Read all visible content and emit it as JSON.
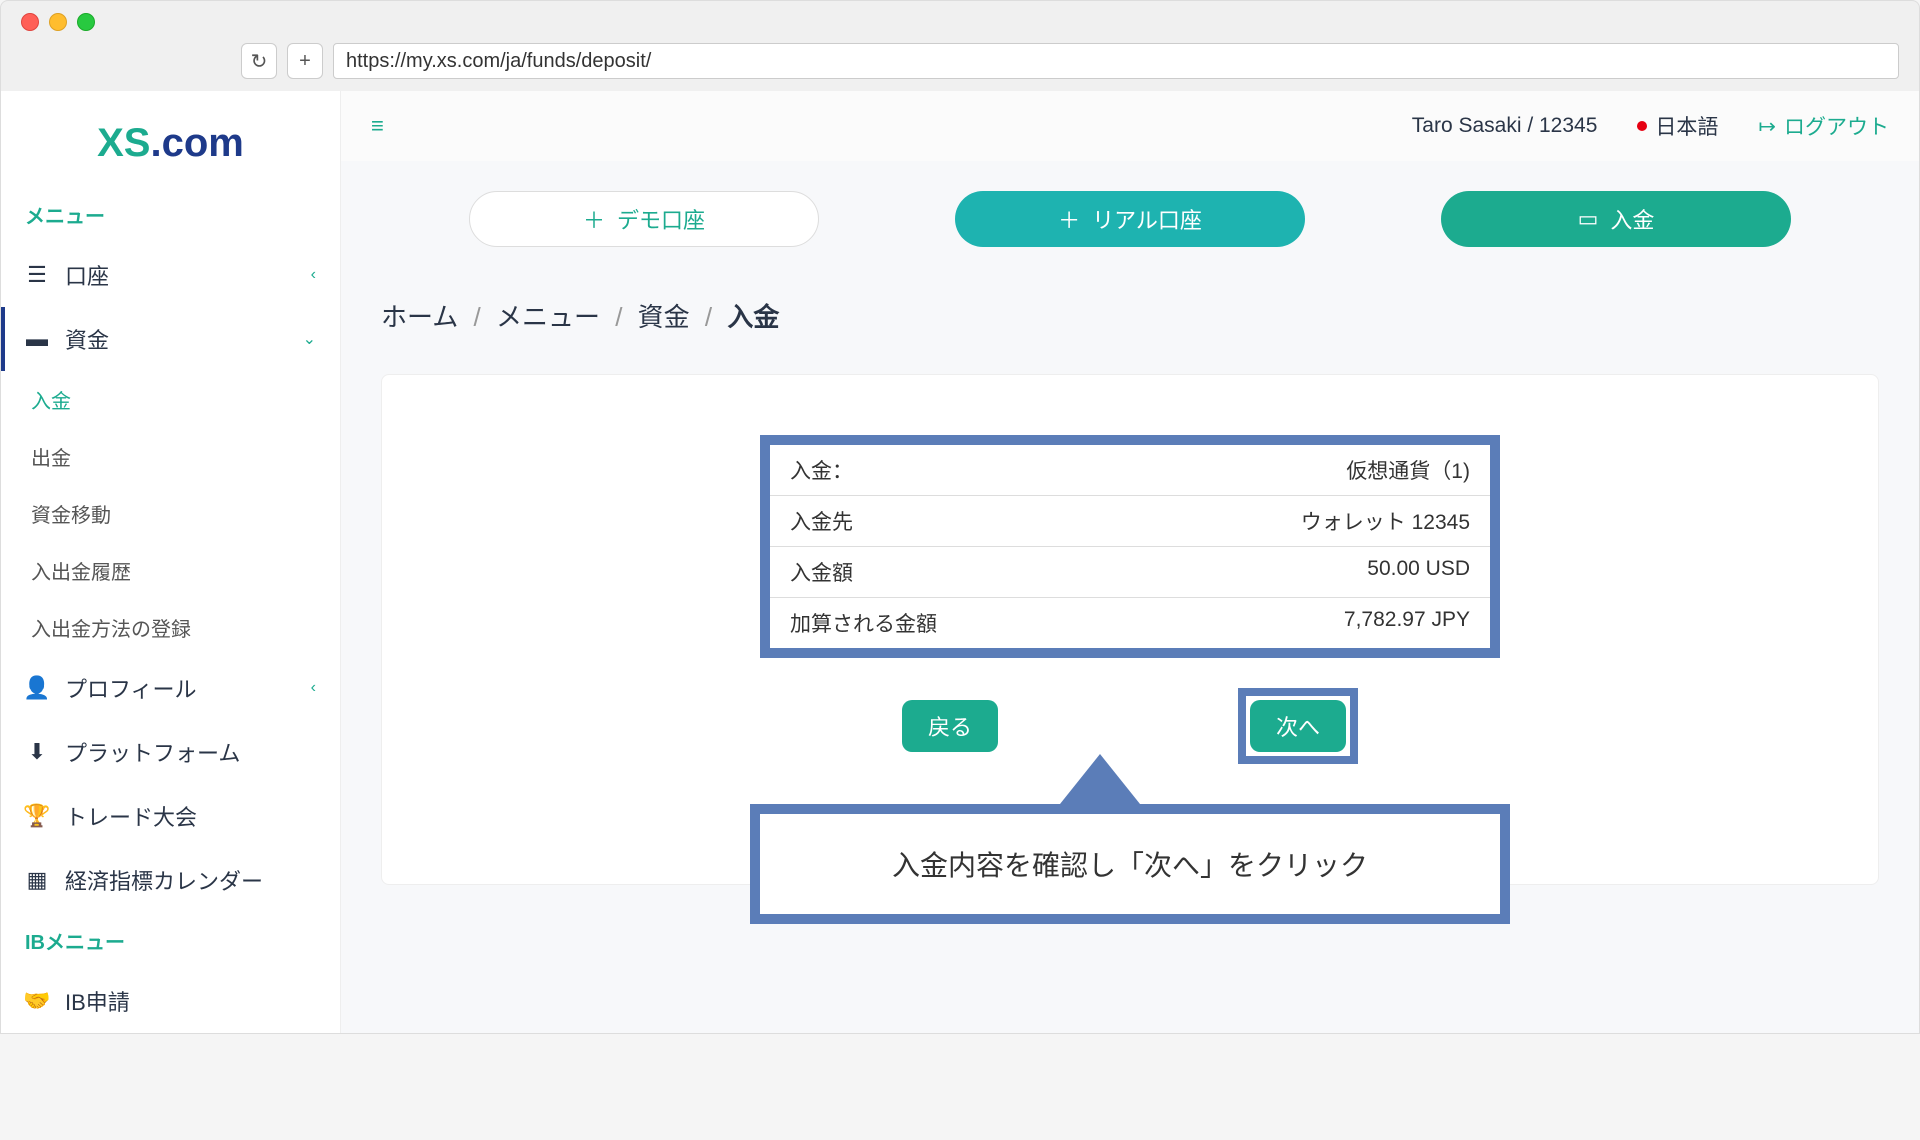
{
  "browser": {
    "url": "https://my.xs.com/ja/funds/deposit/"
  },
  "logo": {
    "xs": "XS",
    "dot": ".",
    "com": "com"
  },
  "sidebar": {
    "menu_header": "メニュー",
    "items": {
      "account": "口座",
      "funds": "資金",
      "profile": "プロフィール",
      "platform": "プラットフォーム",
      "contest": "トレード大会",
      "calendar": "経済指標カレンダー"
    },
    "funds_sub": {
      "deposit": "入金",
      "withdraw": "出金",
      "transfer": "資金移動",
      "history": "入出金履歴",
      "methods": "入出金方法の登録"
    },
    "ib_header": "IBメニュー",
    "ib_apply": "IB申請"
  },
  "topbar": {
    "user": "Taro Sasaki / 12345",
    "language": "日本語",
    "logout": "ログアウト"
  },
  "actions": {
    "demo": "デモ口座",
    "real": "リアル口座",
    "deposit": "入金"
  },
  "breadcrumb": {
    "home": "ホーム",
    "menu": "メニュー",
    "funds": "資金",
    "deposit": "入金"
  },
  "summary": {
    "rows": [
      {
        "label": "入金：",
        "value": "仮想通貨（1)"
      },
      {
        "label": "入金先",
        "value": "ウォレット 12345"
      },
      {
        "label": "入金額",
        "value": "50.00 USD"
      },
      {
        "label": "加算される金額",
        "value": "7,782.97 JPY"
      }
    ]
  },
  "buttons": {
    "back": "戻る",
    "next": "次へ"
  },
  "callout": "入金内容を確認し「次へ」をクリック"
}
